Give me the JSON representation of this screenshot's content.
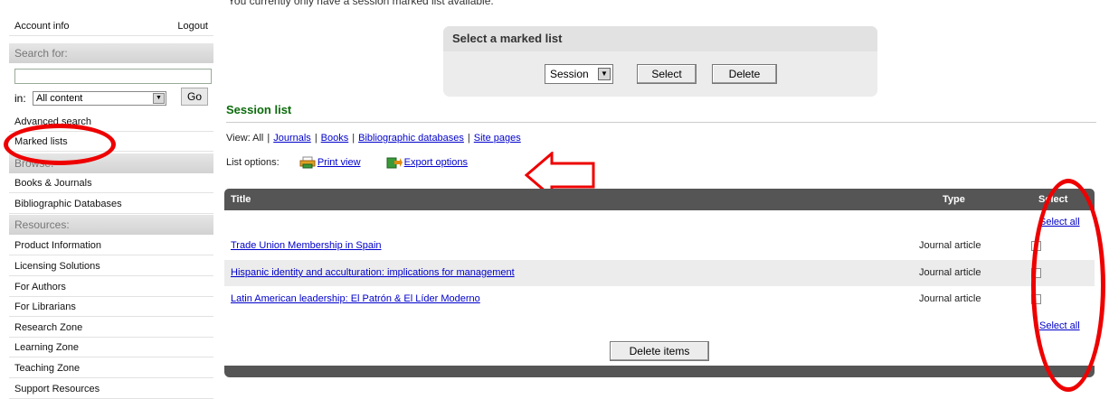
{
  "sidebar": {
    "account_info": "Account info",
    "logout": "Logout",
    "search_heading": "Search for:",
    "search_value": "",
    "scope_label": "in:",
    "scope_value": "All content",
    "go_label": "Go",
    "links": [
      "Advanced search",
      "Marked lists"
    ],
    "browse_heading": "Browse:",
    "browse_items": [
      "Books & Journals",
      "Bibliographic Databases"
    ],
    "resources_heading": "Resources:",
    "resource_items": [
      "Product Information",
      "Licensing Solutions",
      "For Authors",
      "For Librarians",
      "Research Zone",
      "Learning Zone",
      "Teaching Zone",
      "Support Resources"
    ]
  },
  "main": {
    "intro": "You currently only have a session marked list available.",
    "marked_list": {
      "title": "Select a marked list",
      "selected": "Session",
      "select_button": "Select",
      "delete_button": "Delete"
    },
    "session_title": "Session list",
    "view_label": "View: All",
    "view_links": [
      "Journals",
      "Books",
      "Bibliographic databases",
      "Site pages"
    ],
    "list_options_label": "List options:",
    "print_view": "Print view",
    "export_options": "Export options",
    "table": {
      "headers": {
        "title": "Title",
        "type": "Type",
        "select": "Select"
      },
      "select_all": "Select all",
      "rows": [
        {
          "title": "Trade Union Membership in Spain",
          "type": "Journal article"
        },
        {
          "title": "Hispanic identity and acculturation: implications for management",
          "type": "Journal article"
        },
        {
          "title": "Latin American leadership: El Patrón & El Líder Moderno",
          "type": "Journal article"
        }
      ],
      "delete_items": "Delete items"
    }
  },
  "colors": {
    "annotation": "#e00000",
    "heading_green": "#0b6b0b",
    "table_header": "#555555"
  }
}
